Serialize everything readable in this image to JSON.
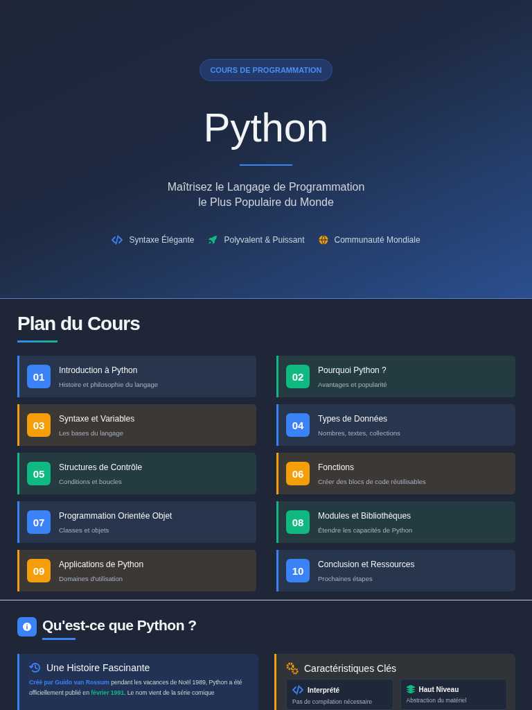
{
  "hero": {
    "badge": "COURS DE PROGRAMMATION",
    "title": "Python",
    "subtitle_lines": [
      "Maîtrisez le Langage de Programmation",
      "le Plus Populaire du Monde"
    ],
    "features": [
      {
        "kind": "code",
        "label": "Syntaxe Élégante",
        "color": "#3b82f6"
      },
      {
        "kind": "rocket",
        "label": "Polyvalent & Puissant",
        "color": "#10b981"
      },
      {
        "kind": "globe",
        "label": "Communauté Mondiale",
        "color": "#f59e0b"
      }
    ]
  },
  "plan": {
    "title": "Plan du Cours",
    "modules": [
      {
        "number": "01",
        "title": "Introduction à Python",
        "subtitle": "Histoire et philosophie du langage",
        "color": "#3b82f6"
      },
      {
        "number": "02",
        "title": "Pourquoi Python ?",
        "subtitle": "Avantages et popularité",
        "color": "#10b981"
      },
      {
        "number": "03",
        "title": "Syntaxe et Variables",
        "subtitle": "Les bases du langage",
        "color": "#f59e0b"
      },
      {
        "number": "04",
        "title": "Types de Données",
        "subtitle": "Nombres, textes, collections",
        "color": "#3b82f6"
      },
      {
        "number": "05",
        "title": "Structures de Contrôle",
        "subtitle": "Conditions et boucles",
        "color": "#10b981"
      },
      {
        "number": "06",
        "title": "Fonctions",
        "subtitle": "Créer des blocs de code réutilisables",
        "color": "#f59e0b"
      },
      {
        "number": "07",
        "title": "Programmation Orientée Objet",
        "subtitle": "Classes et objets",
        "color": "#3b82f6"
      },
      {
        "number": "08",
        "title": "Modules et Bibliothèques",
        "subtitle": "Étendre les capacités de Python",
        "color": "#10b981"
      },
      {
        "number": "09",
        "title": "Applications de Python",
        "subtitle": "Domaines d'utilisation",
        "color": "#f59e0b"
      },
      {
        "number": "10",
        "title": "Conclusion et Ressources",
        "subtitle": "Prochaines étapes",
        "color": "#3b82f6"
      }
    ]
  },
  "about": {
    "title": "Qu'est-ce que Python ?",
    "history": {
      "title": "Une Histoire Fascinante",
      "text": "**Créé par Guido van Rossum** pendant les vacances de Noël 1989, Python a été officiellement publié en **février 1991**. Le nom vient de la série comique"
    },
    "features": {
      "title": "Caractéristiques Clés",
      "items": [
        {
          "kind": "code",
          "title": "Interprété",
          "text": "Pas de compilation nécessaire",
          "color": "#3b82f6"
        },
        {
          "kind": "layers",
          "title": "Haut Niveau",
          "text": "Abstraction du matériel",
          "color": "#10b981"
        }
      ]
    }
  }
}
